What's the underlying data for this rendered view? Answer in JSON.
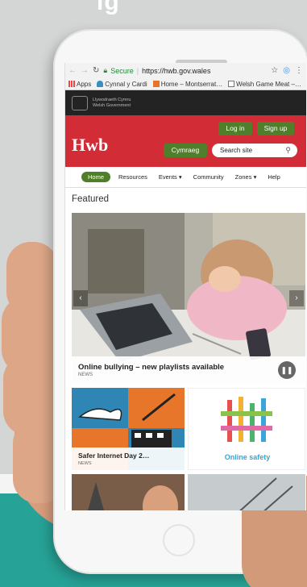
{
  "backdrop": {
    "partial_heading": "ig"
  },
  "browser": {
    "secure_label": "Secure",
    "url": "https://hwb.gov.wales",
    "bookmarks": [
      {
        "label": "Apps",
        "icon": "apps-grid-icon"
      },
      {
        "label": "Cynnal y Cardi",
        "icon": "cloud-icon"
      },
      {
        "label": "Home – Montserrat…",
        "icon": "bookmark-icon"
      },
      {
        "label": "Welsh Game Meat –…",
        "icon": "page-icon"
      }
    ],
    "overflow": "»"
  },
  "gov": {
    "line1": "Llywodraeth Cymru",
    "line2": "Welsh Government"
  },
  "header": {
    "logo": "Hwb",
    "login": "Log in",
    "signup": "Sign up",
    "language": "Cymraeg",
    "search_placeholder": "Search site"
  },
  "nav": {
    "items": [
      "Home",
      "Resources",
      "Events",
      "Community",
      "Zones",
      "Help"
    ],
    "dropdown_marker": "▾"
  },
  "featured": {
    "heading": "Featured"
  },
  "hero": {
    "title": "Online bullying – new playlists available",
    "tag": "NEWS",
    "pause": "❚❚",
    "prev": "‹",
    "next": "›"
  },
  "tiles": [
    {
      "title": "Safer Internet Day 2…",
      "tag": "NEWS"
    },
    {
      "title": "Online safety"
    }
  ],
  "colors": {
    "brand_red": "#d22c36",
    "button_green": "#4f7f2b",
    "teal": "#27a296"
  }
}
